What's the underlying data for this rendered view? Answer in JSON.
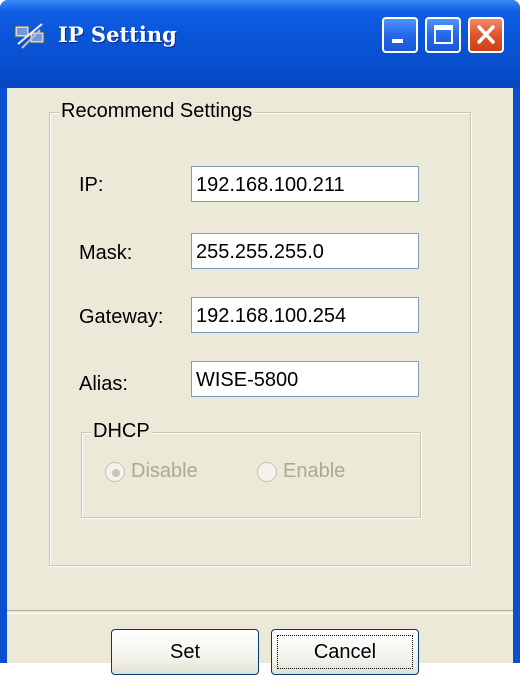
{
  "window": {
    "title": "IP Setting",
    "icon": "network-computer-icon",
    "controls": [
      "minimize-icon",
      "maximize-icon",
      "close-icon"
    ]
  },
  "recommend_group": {
    "legend": "Recommend Settings",
    "fields": {
      "ip": {
        "label": "IP:",
        "value": "192.168.100.211"
      },
      "mask": {
        "label": "Mask:",
        "value": "255.255.255.0"
      },
      "gateway": {
        "label": "Gateway:",
        "value": "192.168.100.254"
      },
      "alias": {
        "label": "Alias:",
        "value": "WISE-5800"
      }
    }
  },
  "dhcp_group": {
    "legend": "DHCP",
    "options": {
      "disable": {
        "label": "Disable",
        "selected": true,
        "enabled": false
      },
      "enable": {
        "label": "Enable",
        "selected": false,
        "enabled": false
      }
    }
  },
  "buttons": {
    "set": "Set",
    "cancel": "Cancel"
  },
  "colors": {
    "titlebar": "#0a55d8",
    "client_bg": "#ece9d8",
    "close_button": "#e0542a"
  }
}
